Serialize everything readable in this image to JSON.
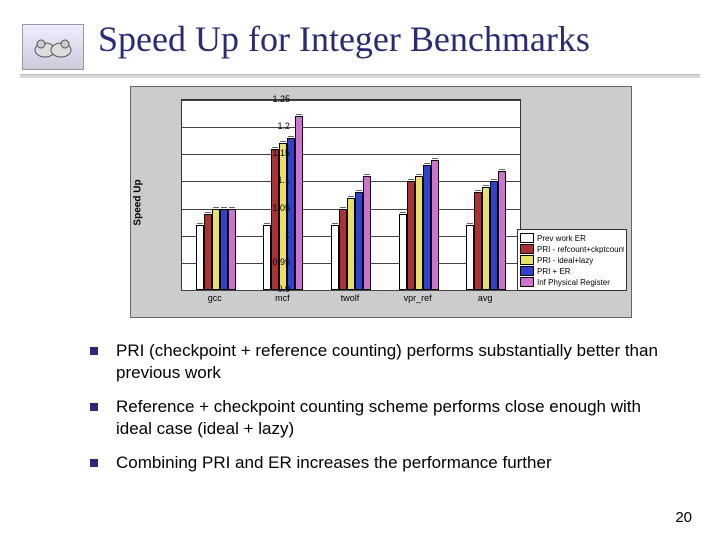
{
  "title": "Speed Up for Integer Benchmarks",
  "page_number": "20",
  "bullets": [
    "PRI (checkpoint + reference counting) performs substantially better than previous work",
    "Reference + checkpoint counting scheme performs close enough with ideal case (ideal + lazy)",
    "Combining PRI and ER increases the performance further"
  ],
  "chart_data": {
    "type": "bar",
    "title": "",
    "note": "width 4",
    "xlabel": "",
    "ylabel": "Speed Up",
    "ylim": [
      0.9,
      1.25
    ],
    "yticks": [
      0.9,
      0.95,
      1.0,
      1.05,
      1.1,
      1.15,
      1.2,
      1.25
    ],
    "categories": [
      "gcc",
      "mcf",
      "twolf",
      "vpr_ref",
      "avg"
    ],
    "series": [
      {
        "name": "Prev work ER",
        "color": "#ffffff",
        "values": [
          1.02,
          1.02,
          1.02,
          1.04,
          1.02
        ]
      },
      {
        "name": "PRI - refcount+ckptcount",
        "color": "#b03030",
        "values": [
          1.04,
          1.16,
          1.05,
          1.1,
          1.08
        ]
      },
      {
        "name": "PRI - ideal+lazy",
        "color": "#e8e060",
        "values": [
          1.05,
          1.17,
          1.07,
          1.11,
          1.09
        ]
      },
      {
        "name": "PRI + ER",
        "color": "#3040d0",
        "values": [
          1.05,
          1.18,
          1.08,
          1.13,
          1.1
        ]
      },
      {
        "name": "Inf Physical Register",
        "color": "#d070d0",
        "values": [
          1.05,
          1.22,
          1.11,
          1.14,
          1.12
        ]
      }
    ]
  }
}
